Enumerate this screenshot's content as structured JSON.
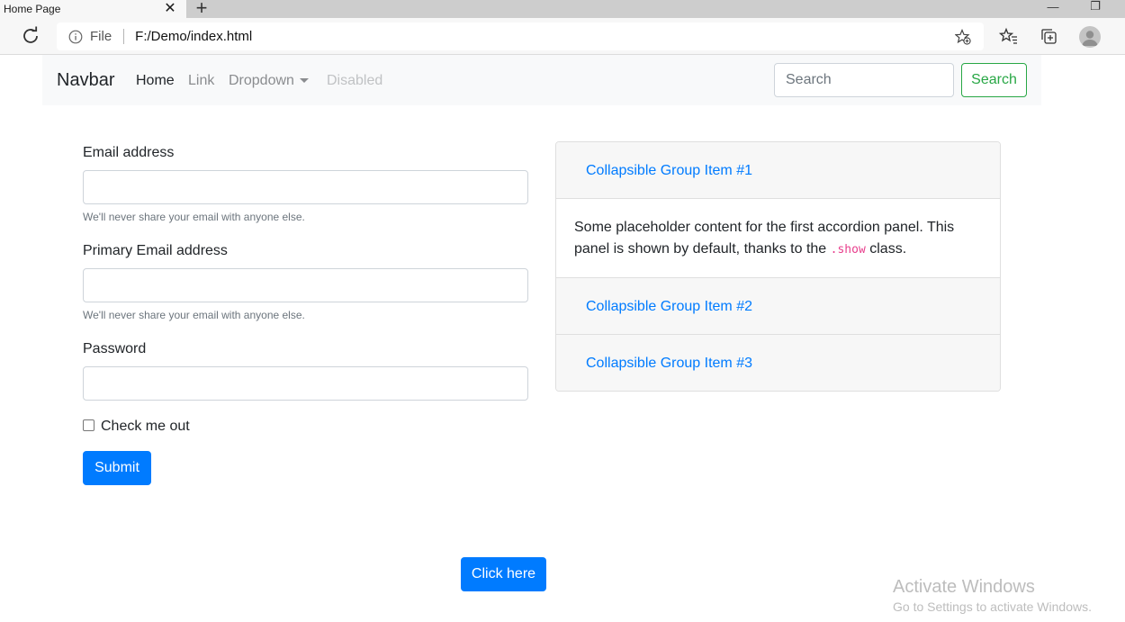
{
  "browser": {
    "tab_title": "Home Page",
    "tab_close": "✕",
    "new_tab": "+",
    "minimize": "—",
    "restore": "❐",
    "url_scheme_label": "File",
    "url": "F:/Demo/index.html"
  },
  "navbar": {
    "brand": "Navbar",
    "items": [
      {
        "label": "Home",
        "state": "active"
      },
      {
        "label": "Link",
        "state": "normal"
      },
      {
        "label": "Dropdown",
        "state": "normal"
      },
      {
        "label": "Disabled",
        "state": "disabled"
      }
    ],
    "search_placeholder": "Search",
    "search_button": "Search"
  },
  "form": {
    "email_label": "Email address",
    "email_help": "We'll never share your email with anyone else.",
    "primary_email_label": "Primary Email address",
    "primary_email_help": "We'll never share your email with anyone else.",
    "password_label": "Password",
    "checkbox_label": "Check me out",
    "checkbox_checked": false,
    "submit_label": "Submit"
  },
  "accordion": {
    "items": [
      {
        "title": "Collapsible Group Item #1",
        "expanded": true
      },
      {
        "title": "Collapsible Group Item #2",
        "expanded": false
      },
      {
        "title": "Collapsible Group Item #3",
        "expanded": false
      }
    ],
    "body_text_before": "Some placeholder content for the first accordion panel. This panel is shown by default, thanks to the",
    "body_code": ".show",
    "body_text_after": "class."
  },
  "bottom_button": "Click here",
  "watermark": {
    "title": "Activate Windows",
    "subtitle": "Go to Settings to activate Windows."
  },
  "colors": {
    "primary": "#007bff",
    "success": "#28a745",
    "code": "#e83e8c"
  }
}
